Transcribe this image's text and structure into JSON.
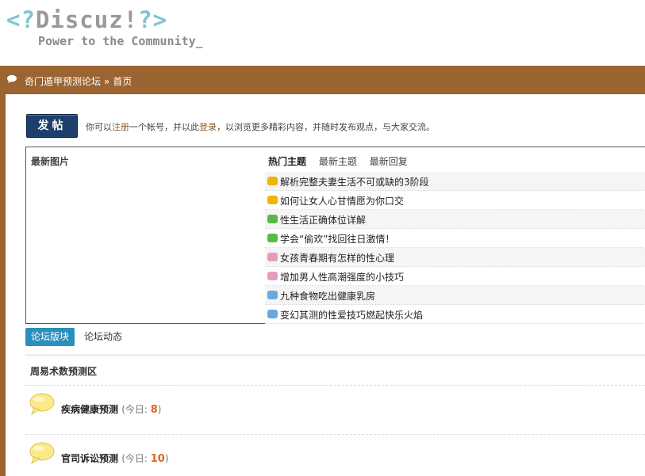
{
  "logo": {
    "open_bracket": "<?",
    "name": "Discuz!",
    "close_bracket": "?>",
    "tagline": "Power to the Community_"
  },
  "breadcrumb": {
    "site": "奇门遁甲预测论坛",
    "separator": "»",
    "current": "首页"
  },
  "post_button": {
    "label": "发帖"
  },
  "notice": {
    "prefix": "你可以",
    "register_link": "注册",
    "mid": "一个帐号，并以此",
    "login_link": "登录",
    "suffix": "，以浏览更多精彩内容，并随时发布观点，与大家交流。"
  },
  "latest_pics": {
    "title": "最新图片"
  },
  "topic_tabs": [
    "热门主题",
    "最新主题",
    "最新回复"
  ],
  "topics": [
    {
      "title": "解析完整夫妻生活不可或缺的3阶段",
      "icon_color": "#f0b400"
    },
    {
      "title": "如何让女人心甘情愿为你口交",
      "icon_color": "#f0b400"
    },
    {
      "title": "性生活正确体位详解",
      "icon_color": "#5ab84a"
    },
    {
      "title": "学会“偷欢”找回往日激情！",
      "icon_color": "#5ab84a"
    },
    {
      "title": "女孩青春期有怎样的性心理",
      "icon_color": "#e79ac0"
    },
    {
      "title": "增加男人性高潮强度的小技巧",
      "icon_color": "#e79ac0"
    },
    {
      "title": "九种食物吃出健康乳房",
      "icon_color": "#6aa8e0"
    },
    {
      "title": "变幻其测的性爱技巧燃起快乐火焰",
      "icon_color": "#6aa8e0"
    }
  ],
  "sub_tabs": {
    "active": "论坛版块",
    "other": "论坛动态"
  },
  "category": {
    "title": "周易术数预测区"
  },
  "forums": [
    {
      "name": "疾病健康预测",
      "today_label": "(今日: ",
      "today_count": "8",
      "close": ")"
    },
    {
      "name": "官司诉讼预测",
      "today_label": "(今日: ",
      "today_count": "10",
      "close": ")"
    }
  ],
  "colors": {
    "navbar": "#9b6431",
    "logo_bracket": "#7fc6cf",
    "post_button": "#1c3f6b",
    "active_tab": "#2a8fbd",
    "count": "#e0651a"
  }
}
